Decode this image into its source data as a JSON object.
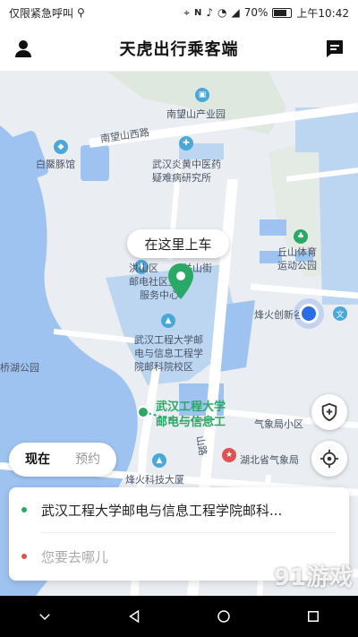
{
  "status_bar": {
    "carrier": "仅限紧急呼叫",
    "battery": "70%",
    "time": "上午10:42"
  },
  "header": {
    "title": "天虎出行乘客端"
  },
  "map": {
    "pickup_prompt": "在这里上车",
    "labels": {
      "nanwangshan_park": "南望山产业园",
      "nanwangshan_road": "南望山西路",
      "baijitun": "白鱀豚馆",
      "yandi_hospital_1": "武汉炎黄中医药",
      "yandi_hospital_2": "疑难病研究所",
      "hongshan_1": "洪山区",
      "hongshan_1b": "关山街",
      "hongshan_2": "邮电社区卫生",
      "hongshan_3": "服务中心",
      "qiushan_1": "丘山体育",
      "qiushan_2": "运动公园",
      "fenghuo": "烽火创新谷",
      "campus_1": "武汉工程大学邮",
      "campus_2": "电与信息工程学",
      "campus_3": "院邮科院校区",
      "bridge_lake": "桥湖公园",
      "current_1": "武汉工程大学",
      "current_2": "邮电与信息工",
      "weather_district": "气象局小区",
      "hubei_weather": "湖北省气象局",
      "shan_road": "山路",
      "fenghuo_building": "烽火科技大厦",
      "wen": "文"
    }
  },
  "mode_toggle": {
    "now": "现在",
    "reserve": "预约"
  },
  "trip_card": {
    "origin": "武汉工程大学邮电与信息工程学院邮科...",
    "destination_placeholder": "您要去哪儿"
  },
  "watermark": "91游戏",
  "colors": {
    "brand_green": "#2aa865",
    "origin_dot": "#2aa865",
    "destination_dot": "#e05252",
    "water": "#9ec3f0",
    "location_blue": "#2a6be6"
  }
}
